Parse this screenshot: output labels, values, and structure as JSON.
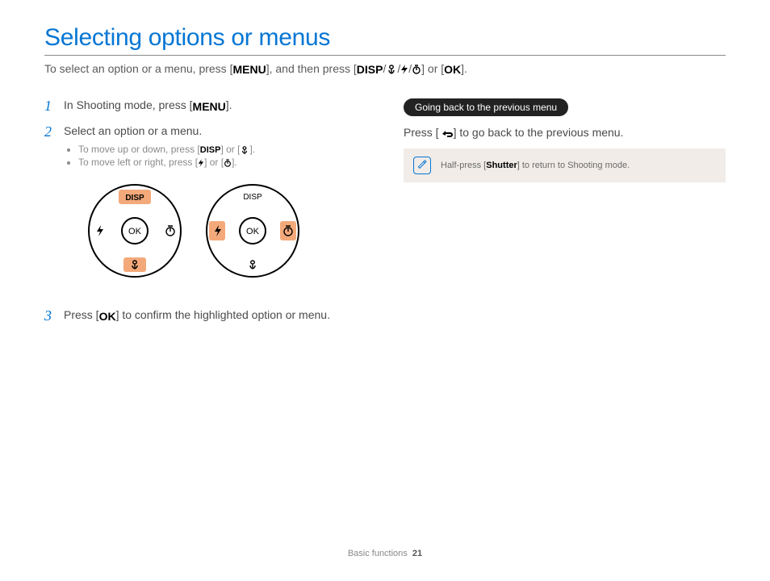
{
  "title": "Selecting options or menus",
  "intro": {
    "before": "To select an option or a menu, press [",
    "menu": "MENU",
    "mid": "], and then press [",
    "disp": "DISP",
    "sep": "/",
    "after_icons": "] or [",
    "ok": "OK",
    "end": "]."
  },
  "steps": {
    "s1": {
      "n": "1",
      "a": "In Shooting mode, press [",
      "menu": "MENU",
      "b": "]."
    },
    "s2": {
      "n": "2",
      "text": "Select an option or a menu.",
      "bullets": {
        "b1a": "To move up or down, press [",
        "disp": "DISP",
        "b1b": "] or [",
        "b1c": "].",
        "b2a": "To move left or right, press [",
        "b2b": "] or [",
        "b2c": "]."
      }
    },
    "s3": {
      "n": "3",
      "a": "Press [",
      "ok": "OK",
      "b": "] to confirm the highlighted option or menu."
    }
  },
  "right": {
    "pill": "Going back to the previous menu",
    "line_a": "Press [",
    "line_b": "] to go back to the previous menu.",
    "note_a": "Half-press [",
    "note_bold": "Shutter",
    "note_b": "] to return to Shooting mode."
  },
  "dial": {
    "disp": "DISP",
    "ok": "OK"
  },
  "footer": {
    "label": "Basic functions",
    "page": "21"
  }
}
